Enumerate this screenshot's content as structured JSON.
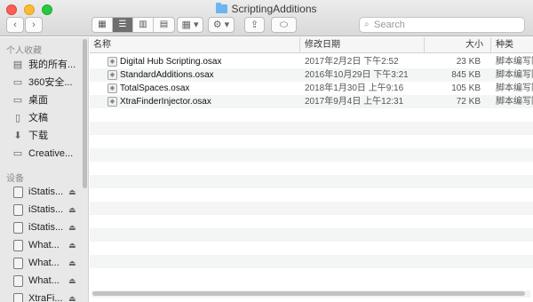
{
  "window": {
    "title": "ScriptingAdditions"
  },
  "toolbar": {
    "back_glyph": "‹",
    "forward_glyph": "›",
    "view_modes": [
      "▦",
      "☰",
      "▥",
      "▤"
    ],
    "arrange_glyph": "▦ ▾",
    "action_glyph": "⚙ ▾",
    "share_glyph": "⇪",
    "tag_glyph": "⬭",
    "search_placeholder": "Search"
  },
  "sidebar": {
    "favorites_header": "个人收藏",
    "favorites": [
      {
        "label": "我的所有...",
        "icon": "all-files-icon",
        "glyph": "▤"
      },
      {
        "label": "360安全...",
        "icon": "folder-icon",
        "glyph": "▭"
      },
      {
        "label": "桌面",
        "icon": "desktop-icon",
        "glyph": "▭"
      },
      {
        "label": "文稿",
        "icon": "document-icon",
        "glyph": "▯"
      },
      {
        "label": "下载",
        "icon": "download-icon",
        "glyph": "⬇"
      },
      {
        "label": "Creative...",
        "icon": "folder-icon",
        "glyph": "▭"
      }
    ],
    "devices_header": "设备",
    "devices": [
      {
        "label": "iStatis...",
        "icon": "disk-icon",
        "eject": "⏏"
      },
      {
        "label": "iStatis...",
        "icon": "disk-icon",
        "eject": "⏏"
      },
      {
        "label": "iStatis...",
        "icon": "disk-icon",
        "eject": "⏏"
      },
      {
        "label": "What...",
        "icon": "disk-icon",
        "eject": "⏏"
      },
      {
        "label": "What...",
        "icon": "disk-icon",
        "eject": "⏏"
      },
      {
        "label": "What...",
        "icon": "disk-icon",
        "eject": "⏏"
      },
      {
        "label": "XtraFi...",
        "icon": "disk-icon",
        "eject": "⏏"
      }
    ]
  },
  "table": {
    "columns": [
      "名称",
      "修改日期",
      "大小",
      "种类"
    ],
    "rows": [
      {
        "name": "Digital Hub Scripting.osax",
        "date": "2017年2月2日 下午2:52",
        "size": "23 KB",
        "kind": "脚本编写附"
      },
      {
        "name": "StandardAdditions.osax",
        "date": "2016年10月29日 下午3:21",
        "size": "845 KB",
        "kind": "脚本编写附"
      },
      {
        "name": "TotalSpaces.osax",
        "date": "2018年1月30日 上午9:16",
        "size": "105 KB",
        "kind": "脚本编写附"
      },
      {
        "name": "XtraFinderInjector.osax",
        "date": "2017年9月4日 上午12:31",
        "size": "72 KB",
        "kind": "脚本编写附"
      }
    ],
    "file_icon": "osax-file-icon",
    "file_glyph": "◆"
  },
  "colors": {
    "accent": "#6f6f6f",
    "close": "#fc5f57",
    "minimize": "#fdbc2e",
    "maximize": "#28c840"
  }
}
